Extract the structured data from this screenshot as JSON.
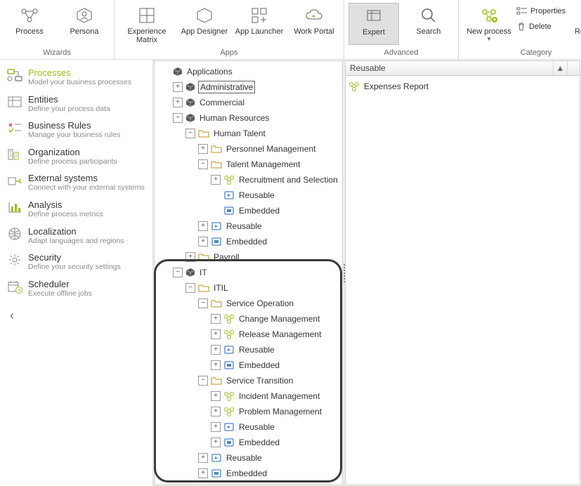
{
  "ribbon": {
    "groups": [
      {
        "label": "Wizards",
        "buttons": [
          {
            "name": "process",
            "label": "Process"
          },
          {
            "name": "persona",
            "label": "Persona"
          }
        ]
      },
      {
        "label": "Apps",
        "buttons": [
          {
            "name": "experience-matrix",
            "label": "Experience\nMatrix"
          },
          {
            "name": "app-designer",
            "label": "App Designer"
          },
          {
            "name": "app-launcher",
            "label": "App Launcher"
          },
          {
            "name": "work-portal",
            "label": "Work Portal"
          }
        ]
      },
      {
        "label": "Advanced",
        "buttons": [
          {
            "name": "expert",
            "label": "Expert",
            "selected": true
          },
          {
            "name": "search",
            "label": "Search"
          }
        ]
      },
      {
        "label": "Category",
        "buttons": [
          {
            "name": "new-process",
            "label": "New process",
            "split": true
          }
        ],
        "small": [
          {
            "name": "properties",
            "label": "Properties"
          },
          {
            "name": "delete",
            "label": "Delete"
          }
        ],
        "right": [
          {
            "name": "refresh",
            "label": "Refresh"
          }
        ]
      }
    ]
  },
  "sidebar": [
    {
      "name": "processes",
      "title": "Processes",
      "sub": "Model your business processes",
      "active": true,
      "icon": "flow"
    },
    {
      "name": "entities",
      "title": "Entities",
      "sub": "Define your process data",
      "icon": "entity"
    },
    {
      "name": "business-rules",
      "title": "Business Rules",
      "sub": "Manage your business rules",
      "icon": "rules"
    },
    {
      "name": "organization",
      "title": "Organization",
      "sub": "Define process participants",
      "icon": "org"
    },
    {
      "name": "external-systems",
      "title": "External systems",
      "sub": "Connect with your external systems",
      "icon": "ext"
    },
    {
      "name": "analysis",
      "title": "Analysis",
      "sub": "Define process metrics",
      "icon": "chart"
    },
    {
      "name": "localization",
      "title": "Localization",
      "sub": "Adapt languages and regions",
      "icon": "globe"
    },
    {
      "name": "security",
      "title": "Security",
      "sub": "Define your security settings",
      "icon": "gear"
    },
    {
      "name": "scheduler",
      "title": "Scheduler",
      "sub": "Execute offline jobs",
      "icon": "clock"
    }
  ],
  "tree": [
    {
      "d": 0,
      "tw": "",
      "ic": "cube",
      "lbl": "Applications"
    },
    {
      "d": 1,
      "tw": "+",
      "ic": "cube",
      "lbl": "Administrative",
      "boxsel": true
    },
    {
      "d": 1,
      "tw": "+",
      "ic": "cube",
      "lbl": "Commercial"
    },
    {
      "d": 1,
      "tw": "-",
      "ic": "cube",
      "lbl": "Human Resources"
    },
    {
      "d": 2,
      "tw": "-",
      "ic": "folder",
      "lbl": "Human Talent"
    },
    {
      "d": 3,
      "tw": "+",
      "ic": "folder",
      "lbl": "Personnel Management"
    },
    {
      "d": 3,
      "tw": "-",
      "ic": "folder",
      "lbl": "Talent Management"
    },
    {
      "d": 4,
      "tw": "+",
      "ic": "proc",
      "lbl": "Recruitment and Selection"
    },
    {
      "d": 4,
      "tw": "",
      "ic": "reus",
      "lbl": "Reusable"
    },
    {
      "d": 4,
      "tw": "",
      "ic": "emb",
      "lbl": "Embedded"
    },
    {
      "d": 3,
      "tw": "+",
      "ic": "reus",
      "lbl": "Reusable"
    },
    {
      "d": 3,
      "tw": "+",
      "ic": "emb",
      "lbl": "Embedded"
    },
    {
      "d": 2,
      "tw": "+",
      "ic": "folder",
      "lbl": "Payroll"
    },
    {
      "d": 1,
      "tw": "-",
      "ic": "cube",
      "lbl": "IT"
    },
    {
      "d": 2,
      "tw": "-",
      "ic": "folder",
      "lbl": "ITIL"
    },
    {
      "d": 3,
      "tw": "-",
      "ic": "folder",
      "lbl": "Service Operation"
    },
    {
      "d": 4,
      "tw": "+",
      "ic": "proc",
      "lbl": "Change Management"
    },
    {
      "d": 4,
      "tw": "+",
      "ic": "proc",
      "lbl": "Release Management"
    },
    {
      "d": 4,
      "tw": "+",
      "ic": "reus",
      "lbl": "Reusable"
    },
    {
      "d": 4,
      "tw": "+",
      "ic": "emb",
      "lbl": "Embedded"
    },
    {
      "d": 3,
      "tw": "-",
      "ic": "folder",
      "lbl": "Service Transition"
    },
    {
      "d": 4,
      "tw": "+",
      "ic": "proc",
      "lbl": "Incident Management"
    },
    {
      "d": 4,
      "tw": "+",
      "ic": "proc",
      "lbl": "Problem Management"
    },
    {
      "d": 4,
      "tw": "+",
      "ic": "reus",
      "lbl": "Reusable"
    },
    {
      "d": 4,
      "tw": "+",
      "ic": "emb",
      "lbl": "Embedded"
    },
    {
      "d": 3,
      "tw": "+",
      "ic": "reus",
      "lbl": "Reusable"
    },
    {
      "d": 3,
      "tw": "+",
      "ic": "emb",
      "lbl": "Embedded"
    }
  ],
  "list": {
    "header": "Reusable",
    "items": [
      {
        "name": "expenses-report",
        "label": "Expenses Report"
      }
    ]
  }
}
